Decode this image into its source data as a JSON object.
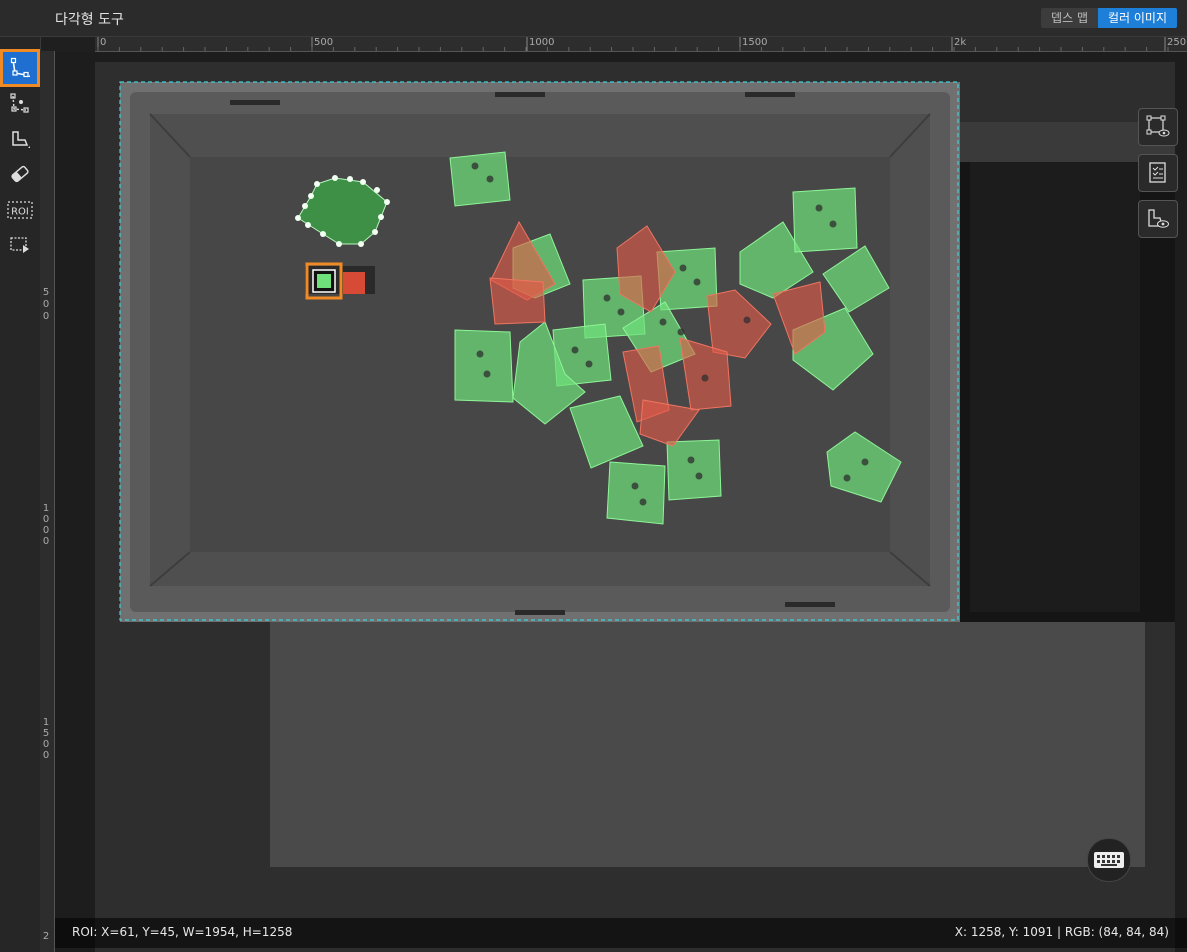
{
  "header": {
    "title": "다각형 도구",
    "view_toggle": {
      "depth_map": "뎁스 맵",
      "color_image": "컬러 이미지",
      "selected": "컬러 이미지"
    }
  },
  "toolbar": {
    "tools": [
      {
        "name": "polygon-tool",
        "active": true
      },
      {
        "name": "point-edit-tool",
        "active": false
      },
      {
        "name": "auto-label-tool",
        "active": false
      },
      {
        "name": "eraser-tool",
        "active": false
      },
      {
        "name": "roi-tool",
        "active": false
      },
      {
        "name": "export-tool",
        "active": false
      }
    ],
    "roi_label": "ROI"
  },
  "ruler": {
    "top": [
      "0",
      "500",
      "1000",
      "1500",
      "2k",
      "250"
    ],
    "left": [
      "5 0 0",
      "1 0 0 0",
      "1 5 0 0",
      "2"
    ]
  },
  "status": {
    "roi": "ROI: X=61, Y=45, W=1954, H=1258",
    "cursor": "X: 1258, Y: 1091 | RGB: (84, 84, 84)"
  },
  "colors": {
    "accent": "#1e7fd8",
    "highlight": "#f08a24",
    "label_green": "#6fe07a",
    "label_red": "#e25b48",
    "roi_border": "#3fd0d8"
  },
  "right_tools": [
    "show-vertices-icon",
    "label-list-icon",
    "show-mask-icon"
  ]
}
